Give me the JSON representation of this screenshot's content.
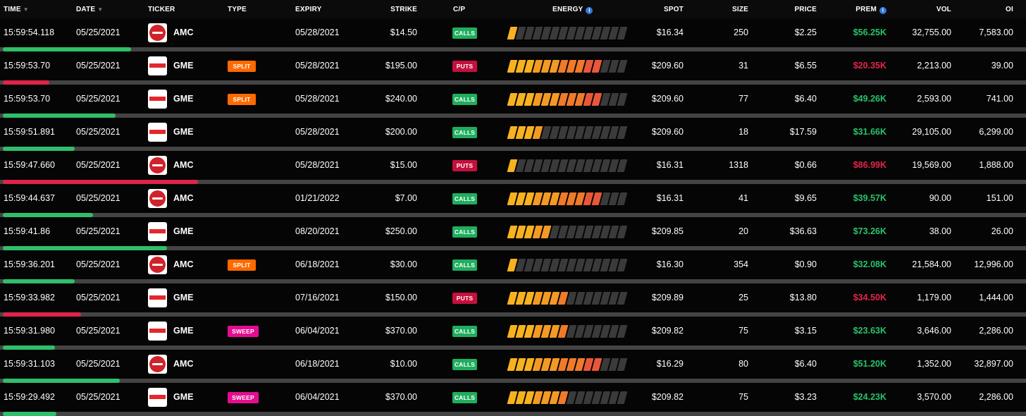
{
  "columns": {
    "time": "TIME",
    "date": "DATE",
    "ticker": "TICKER",
    "type": "TYPE",
    "expiry": "EXPIRY",
    "strike": "STRIKE",
    "cp": "C/P",
    "energy": "ENERGY",
    "spot": "SPOT",
    "size": "SIZE",
    "price": "PRICE",
    "prem": "PREM",
    "vol": "VOL",
    "oi": "OI"
  },
  "colors": {
    "calls": "#1fae5e",
    "puts": "#c5103d",
    "split": "#ff6a00",
    "sweep": "#e40d8f",
    "energy_empty": "#3a3a3a",
    "energy_gradient": [
      "#f7b21f",
      "#f39a24",
      "#ee7a2a",
      "#e9573a",
      "#e0234a"
    ]
  },
  "rows": [
    {
      "time": "15:59:54.118",
      "date": "05/25/2021",
      "ticker": "AMC",
      "type": "",
      "expiry": "05/28/2021",
      "strike": "$14.50",
      "cp": "CALLS",
      "energy": 1,
      "spot": "$16.34",
      "size": "250",
      "price": "$2.25",
      "prem": "$56.25K",
      "vol": "32,755.00",
      "oi": "7,583.00",
      "bar": 0.125
    },
    {
      "time": "15:59:53.70",
      "date": "05/25/2021",
      "ticker": "GME",
      "type": "SPLIT",
      "expiry": "05/28/2021",
      "strike": "$195.00",
      "cp": "PUTS",
      "energy": 11,
      "spot": "$209.60",
      "size": "31",
      "price": "$6.55",
      "prem": "$20.35K",
      "vol": "2,213.00",
      "oi": "39.00",
      "bar": 0.045
    },
    {
      "time": "15:59:53.70",
      "date": "05/25/2021",
      "ticker": "GME",
      "type": "SPLIT",
      "expiry": "05/28/2021",
      "strike": "$240.00",
      "cp": "CALLS",
      "energy": 11,
      "spot": "$209.60",
      "size": "77",
      "price": "$6.40",
      "prem": "$49.26K",
      "vol": "2,593.00",
      "oi": "741.00",
      "bar": 0.11
    },
    {
      "time": "15:59:51.891",
      "date": "05/25/2021",
      "ticker": "GME",
      "type": "",
      "expiry": "05/28/2021",
      "strike": "$200.00",
      "cp": "CALLS",
      "energy": 4,
      "spot": "$209.60",
      "size": "18",
      "price": "$17.59",
      "prem": "$31.66K",
      "vol": "29,105.00",
      "oi": "6,299.00",
      "bar": 0.07
    },
    {
      "time": "15:59:47.660",
      "date": "05/25/2021",
      "ticker": "AMC",
      "type": "",
      "expiry": "05/28/2021",
      "strike": "$15.00",
      "cp": "PUTS",
      "energy": 1,
      "spot": "$16.31",
      "size": "1318",
      "price": "$0.66",
      "prem": "$86.99K",
      "vol": "19,569.00",
      "oi": "1,888.00",
      "bar": 0.19
    },
    {
      "time": "15:59:44.637",
      "date": "05/25/2021",
      "ticker": "AMC",
      "type": "",
      "expiry": "01/21/2022",
      "strike": "$7.00",
      "cp": "CALLS",
      "energy": 11,
      "spot": "$16.31",
      "size": "41",
      "price": "$9.65",
      "prem": "$39.57K",
      "vol": "90.00",
      "oi": "151.00",
      "bar": 0.088
    },
    {
      "time": "15:59:41.86",
      "date": "05/25/2021",
      "ticker": "GME",
      "type": "",
      "expiry": "08/20/2021",
      "strike": "$250.00",
      "cp": "CALLS",
      "energy": 5,
      "spot": "$209.85",
      "size": "20",
      "price": "$36.63",
      "prem": "$73.26K",
      "vol": "38.00",
      "oi": "26.00",
      "bar": 0.16
    },
    {
      "time": "15:59:36.201",
      "date": "05/25/2021",
      "ticker": "AMC",
      "type": "SPLIT",
      "expiry": "06/18/2021",
      "strike": "$30.00",
      "cp": "CALLS",
      "energy": 1,
      "spot": "$16.30",
      "size": "354",
      "price": "$0.90",
      "prem": "$32.08K",
      "vol": "21,584.00",
      "oi": "12,996.00",
      "bar": 0.07
    },
    {
      "time": "15:59:33.982",
      "date": "05/25/2021",
      "ticker": "GME",
      "type": "",
      "expiry": "07/16/2021",
      "strike": "$150.00",
      "cp": "PUTS",
      "energy": 7,
      "spot": "$209.89",
      "size": "25",
      "price": "$13.80",
      "prem": "$34.50K",
      "vol": "1,179.00",
      "oi": "1,444.00",
      "bar": 0.076
    },
    {
      "time": "15:59:31.980",
      "date": "05/25/2021",
      "ticker": "GME",
      "type": "SWEEP",
      "expiry": "06/04/2021",
      "strike": "$370.00",
      "cp": "CALLS",
      "energy": 7,
      "spot": "$209.82",
      "size": "75",
      "price": "$3.15",
      "prem": "$23.63K",
      "vol": "3,646.00",
      "oi": "2,286.00",
      "bar": 0.051
    },
    {
      "time": "15:59:31.103",
      "date": "05/25/2021",
      "ticker": "AMC",
      "type": "",
      "expiry": "06/18/2021",
      "strike": "$10.00",
      "cp": "CALLS",
      "energy": 11,
      "spot": "$16.29",
      "size": "80",
      "price": "$6.40",
      "prem": "$51.20K",
      "vol": "1,352.00",
      "oi": "32,897.00",
      "bar": 0.114
    },
    {
      "time": "15:59:29.492",
      "date": "05/25/2021",
      "ticker": "GME",
      "type": "SWEEP",
      "expiry": "06/04/2021",
      "strike": "$370.00",
      "cp": "CALLS",
      "energy": 7,
      "spot": "$209.82",
      "size": "75",
      "price": "$3.23",
      "prem": "$24.23K",
      "vol": "3,570.00",
      "oi": "2,286.00",
      "bar": 0.052
    }
  ]
}
